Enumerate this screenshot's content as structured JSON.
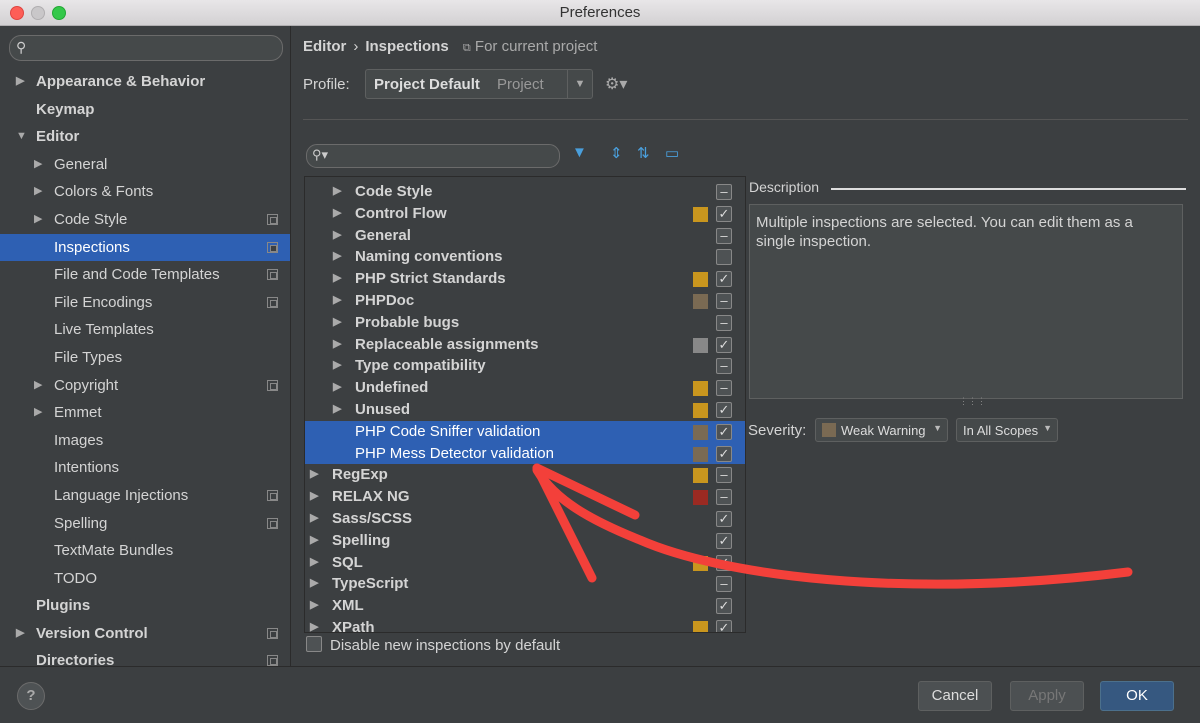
{
  "window": {
    "title": "Preferences"
  },
  "sidebar": {
    "search_placeholder": "",
    "items": [
      {
        "label": "Appearance & Behavior",
        "level": 0,
        "arrow": "▶",
        "bold": true,
        "copy": false
      },
      {
        "label": "Keymap",
        "level": 0,
        "arrow": "",
        "bold": true,
        "copy": false
      },
      {
        "label": "Editor",
        "level": 0,
        "arrow": "▼",
        "bold": true,
        "copy": false
      },
      {
        "label": "General",
        "level": 1,
        "arrow": "▶",
        "bold": false,
        "copy": false
      },
      {
        "label": "Colors & Fonts",
        "level": 1,
        "arrow": "▶",
        "bold": false,
        "copy": false
      },
      {
        "label": "Code Style",
        "level": 1,
        "arrow": "▶",
        "bold": false,
        "copy": true
      },
      {
        "label": "Inspections",
        "level": 1,
        "arrow": "",
        "bold": false,
        "copy": true,
        "selected": true
      },
      {
        "label": "File and Code Templates",
        "level": 1,
        "arrow": "",
        "bold": false,
        "copy": true
      },
      {
        "label": "File Encodings",
        "level": 1,
        "arrow": "",
        "bold": false,
        "copy": true
      },
      {
        "label": "Live Templates",
        "level": 1,
        "arrow": "",
        "bold": false,
        "copy": false
      },
      {
        "label": "File Types",
        "level": 1,
        "arrow": "",
        "bold": false,
        "copy": false
      },
      {
        "label": "Copyright",
        "level": 1,
        "arrow": "▶",
        "bold": false,
        "copy": true
      },
      {
        "label": "Emmet",
        "level": 1,
        "arrow": "▶",
        "bold": false,
        "copy": false
      },
      {
        "label": "Images",
        "level": 1,
        "arrow": "",
        "bold": false,
        "copy": false
      },
      {
        "label": "Intentions",
        "level": 1,
        "arrow": "",
        "bold": false,
        "copy": false
      },
      {
        "label": "Language Injections",
        "level": 1,
        "arrow": "",
        "bold": false,
        "copy": true
      },
      {
        "label": "Spelling",
        "level": 1,
        "arrow": "",
        "bold": false,
        "copy": true
      },
      {
        "label": "TextMate Bundles",
        "level": 1,
        "arrow": "",
        "bold": false,
        "copy": false
      },
      {
        "label": "TODO",
        "level": 1,
        "arrow": "",
        "bold": false,
        "copy": false
      },
      {
        "label": "Plugins",
        "level": 0,
        "arrow": "",
        "bold": true,
        "copy": false
      },
      {
        "label": "Version Control",
        "level": 0,
        "arrow": "▶",
        "bold": true,
        "copy": true
      },
      {
        "label": "Directories",
        "level": 0,
        "arrow": "",
        "bold": true,
        "copy": true
      }
    ]
  },
  "header": {
    "breadcrumb_1": "Editor",
    "breadcrumb_sep": "›",
    "breadcrumb_2": "Inspections",
    "scope_note": "For current project",
    "profile_label": "Profile:",
    "profile_value": "Project Default",
    "profile_scope": "Project"
  },
  "inspections": {
    "search_placeholder": "",
    "rows": [
      {
        "label": "Code Style",
        "indent": 1,
        "color": "",
        "check": "–",
        "selected": false
      },
      {
        "label": "Control Flow",
        "indent": 1,
        "color": "#c9961e",
        "check": "✓",
        "selected": false
      },
      {
        "label": "General",
        "indent": 1,
        "color": "",
        "check": "–",
        "selected": false
      },
      {
        "label": "Naming conventions",
        "indent": 1,
        "color": "",
        "check": "",
        "selected": false
      },
      {
        "label": "PHP Strict Standards",
        "indent": 1,
        "color": "#c9961e",
        "check": "✓",
        "selected": false
      },
      {
        "label": "PHPDoc",
        "indent": 1,
        "color": "#7a6a53",
        "check": "–",
        "selected": false
      },
      {
        "label": "Probable bugs",
        "indent": 1,
        "color": "",
        "check": "–",
        "selected": false
      },
      {
        "label": "Replaceable assignments",
        "indent": 1,
        "color": "#888888",
        "check": "✓",
        "selected": false
      },
      {
        "label": "Type compatibility",
        "indent": 1,
        "color": "",
        "check": "–",
        "selected": false
      },
      {
        "label": "Undefined",
        "indent": 1,
        "color": "#c9961e",
        "check": "–",
        "selected": false
      },
      {
        "label": "Unused",
        "indent": 1,
        "color": "#c9961e",
        "check": "✓",
        "selected": false
      },
      {
        "label": "PHP Code Sniffer validation",
        "indent": 1,
        "color": "#7a6a53",
        "check": "✓",
        "selected": true,
        "leaf": true
      },
      {
        "label": "PHP Mess Detector validation",
        "indent": 1,
        "color": "#7a6a53",
        "check": "✓",
        "selected": true,
        "leaf": true
      },
      {
        "label": "RegExp",
        "indent": 0,
        "color": "#c9961e",
        "check": "–",
        "selected": false
      },
      {
        "label": "RELAX NG",
        "indent": 0,
        "color": "#9b2a22",
        "check": "–",
        "selected": false
      },
      {
        "label": "Sass/SCSS",
        "indent": 0,
        "color": "",
        "check": "✓",
        "selected": false
      },
      {
        "label": "Spelling",
        "indent": 0,
        "color": "",
        "check": "✓",
        "selected": false
      },
      {
        "label": "SQL",
        "indent": 0,
        "color": "#c9961e",
        "check": "✓",
        "selected": false
      },
      {
        "label": "TypeScript",
        "indent": 0,
        "color": "",
        "check": "–",
        "selected": false
      },
      {
        "label": "XML",
        "indent": 0,
        "color": "",
        "check": "✓",
        "selected": false
      },
      {
        "label": "XPath",
        "indent": 0,
        "color": "#c9961e",
        "check": "✓",
        "selected": false
      }
    ],
    "disable_label": "Disable new inspections by default"
  },
  "description": {
    "label": "Description",
    "text": "Multiple inspections are selected. You can edit them as a single inspection.",
    "severity_label": "Severity:",
    "severity_value": "Weak Warning",
    "scope_value": "In All Scopes"
  },
  "footer": {
    "help": "?",
    "cancel": "Cancel",
    "apply": "Apply",
    "ok": "OK"
  }
}
